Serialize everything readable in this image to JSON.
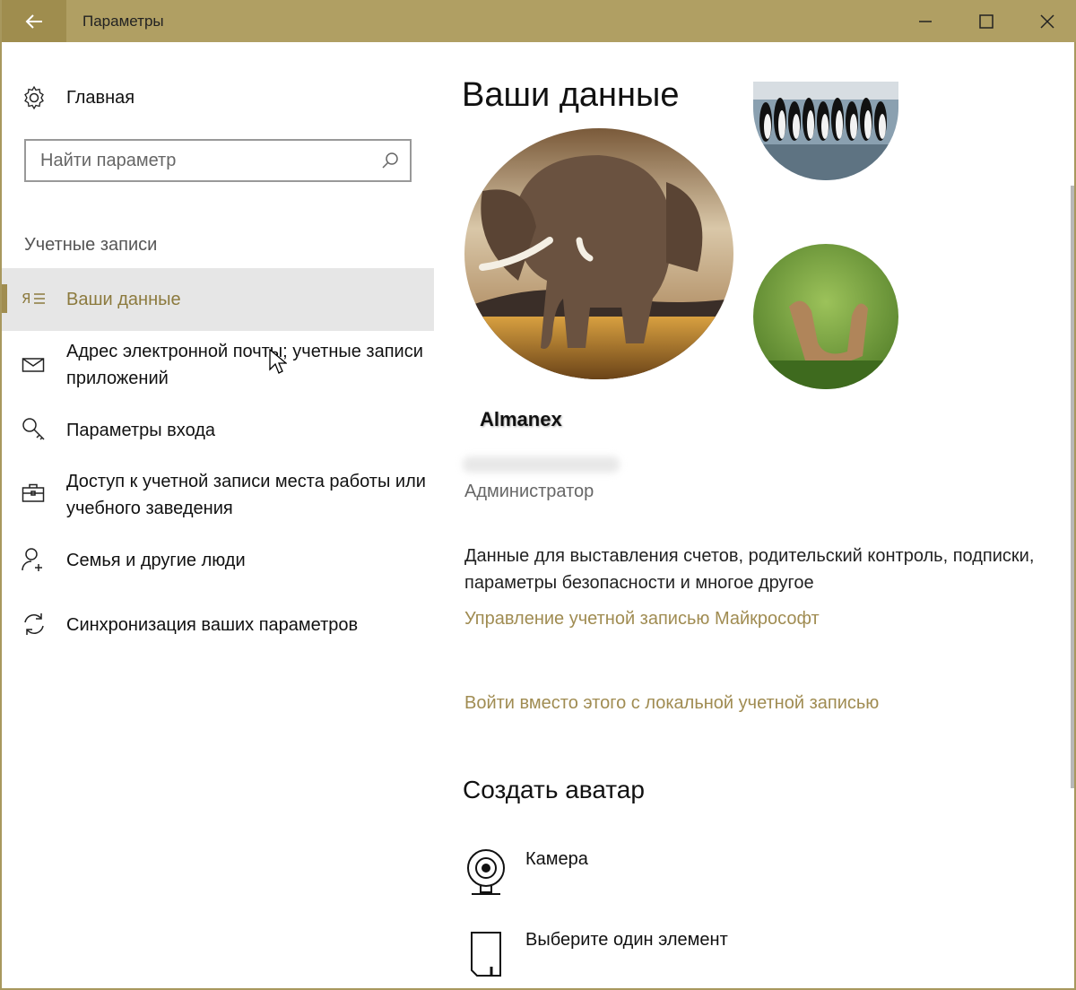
{
  "window": {
    "title": "Параметры"
  },
  "sidebar": {
    "home_label": "Главная",
    "search_placeholder": "Найти параметр",
    "section_label": "Учетные записи",
    "items": [
      {
        "label": "Ваши данные",
        "icon": "user-info-icon",
        "selected": true
      },
      {
        "label": "Адрес электронной почты; учетные записи приложений",
        "icon": "mail-icon"
      },
      {
        "label": "Параметры входа",
        "icon": "key-icon"
      },
      {
        "label": "Доступ к учетной записи места работы или учебного заведения",
        "icon": "briefcase-icon"
      },
      {
        "label": "Семья и другие люди",
        "icon": "add-person-icon"
      },
      {
        "label": "Синхронизация ваших параметров",
        "icon": "sync-icon"
      }
    ]
  },
  "main": {
    "title": "Ваши данные",
    "user_name": "Almanex",
    "role": "Администратор",
    "description": "Данные для выставления счетов, родительский контроль, подписки, параметры безопасности и многое другое",
    "manage_link": "Управление учетной записью Майкрософт",
    "local_link": "Войти вместо этого с локальной учетной записью",
    "create_avatar_title": "Создать аватар",
    "create_items": [
      {
        "label": "Камера",
        "icon": "webcam-icon"
      },
      {
        "label": "Выберите один элемент",
        "icon": "file-browse-icon"
      }
    ]
  },
  "colors": {
    "titlebar": "#b09f63",
    "accent": "#a08c52",
    "selected_bg": "#e6e6e6"
  }
}
